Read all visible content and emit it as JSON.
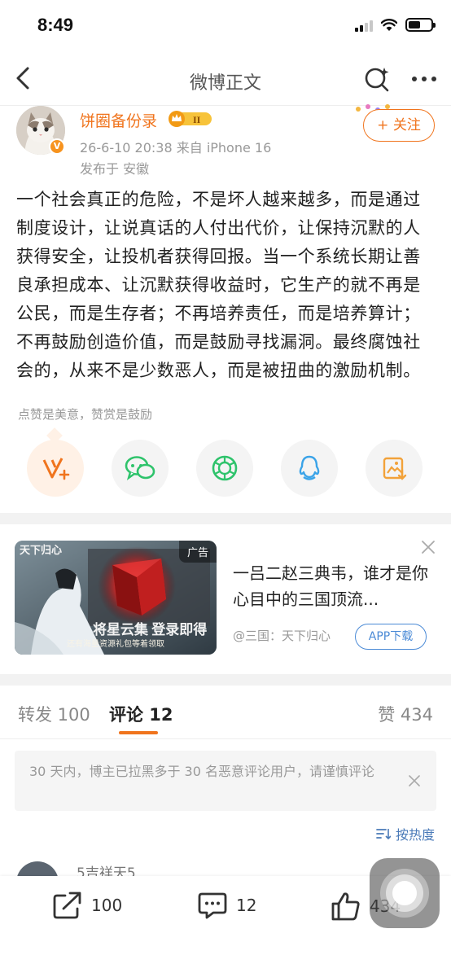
{
  "status": {
    "time": "8:49"
  },
  "nav": {
    "title": "微博正文"
  },
  "author": {
    "name": "饼圈备份录",
    "level_badge": "II",
    "verified_badge": "V",
    "meta": "26-6-10 20:38  来自 iPhone 16",
    "location": "发布于 安徽",
    "follow_label": "+ 关注"
  },
  "post": {
    "text": "一个社会真正的危险，不是坏人越来越多，而是通过制度设计，让说真话的人付出代价，让保持沉默的人获得安全，让投机者获得回报。当一个系统长期让善良承担成本、让沉默获得收益时，它生产的就不再是公民，而是生存者；不再培养责任，而是培养算计；不再鼓励创造价值，而是鼓励寻找漏洞。最终腐蚀社会的，从来不是少数恶人，而是被扭曲的激励机制。"
  },
  "reward": {
    "tip": "点赞是美意，赞赏是鼓励"
  },
  "share_icons": [
    "reward-v-icon",
    "wechat-icon",
    "moments-icon",
    "qq-icon",
    "save-image-icon"
  ],
  "ad": {
    "tag": "广告",
    "image_logo": "天下归心",
    "image_slogan": "将星云集 登录即得",
    "image_caption": "还有海量资源礼包等着领取",
    "title": "一吕二赵三典韦，谁才是你心目中的三国顶流...",
    "source": "@三国：天下归心",
    "download_label": "APP下载"
  },
  "tabs": [
    {
      "label": "转发 100"
    },
    {
      "label": "评论 12"
    },
    {
      "label": "赞 434"
    }
  ],
  "notice": {
    "text": "30 天内，博主已拉黑多于 30 名恶意评论用户，请谨慎评论"
  },
  "sort": {
    "label": "按热度"
  },
  "comment_preview": {
    "user": "5吉祥天5"
  },
  "bottom": {
    "repost": "100",
    "comment": "12",
    "like": "434"
  },
  "colors": {
    "accent": "#f0741d",
    "link": "#4a7ab8",
    "wechat": "#2ec36b",
    "qq": "#3aa3e8",
    "save": "#f2a23a"
  }
}
